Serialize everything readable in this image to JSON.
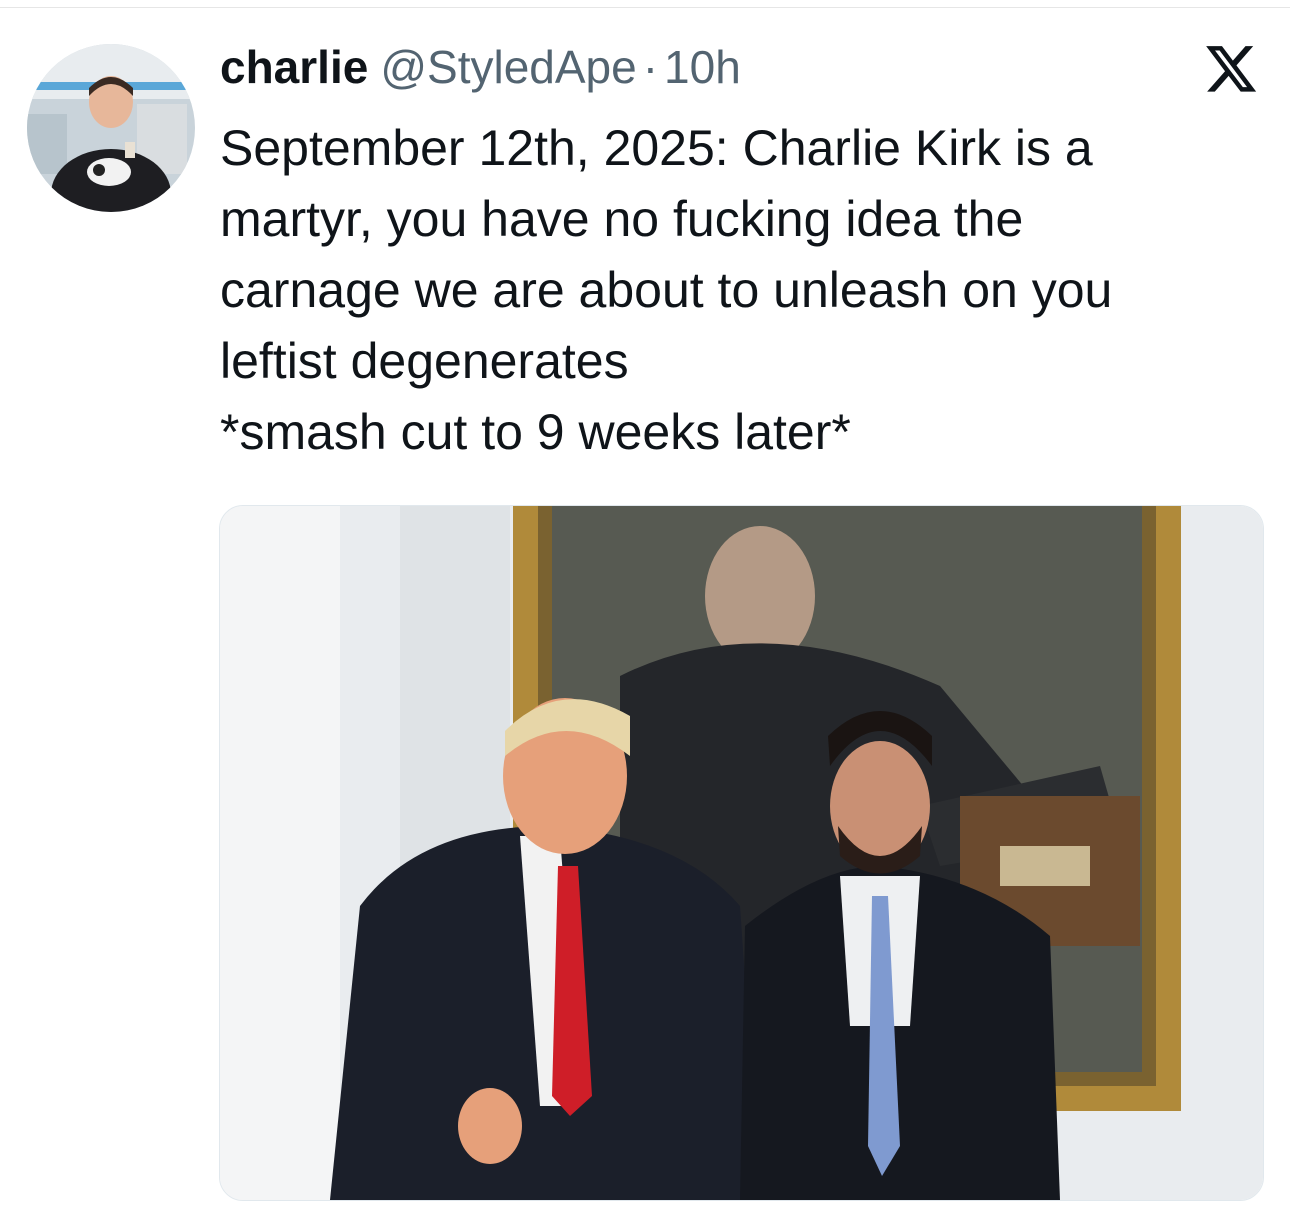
{
  "tweet": {
    "display_name": "charlie",
    "handle": "@StyledApe",
    "separator": "·",
    "time": "10h",
    "text_lines": [
      "September 12th, 2025: Charlie Kirk is a",
      "martyr, you have no fucking idea the",
      "carnage we are about to unleash on you",
      "leftist degenerates",
      "*smash cut to 9 weeks later*"
    ]
  },
  "icons": {
    "brand": "x-logo-icon",
    "avatar": "profile-avatar"
  },
  "colors": {
    "text_primary": "#0f1419",
    "text_secondary": "#536471",
    "background": "#ffffff"
  }
}
